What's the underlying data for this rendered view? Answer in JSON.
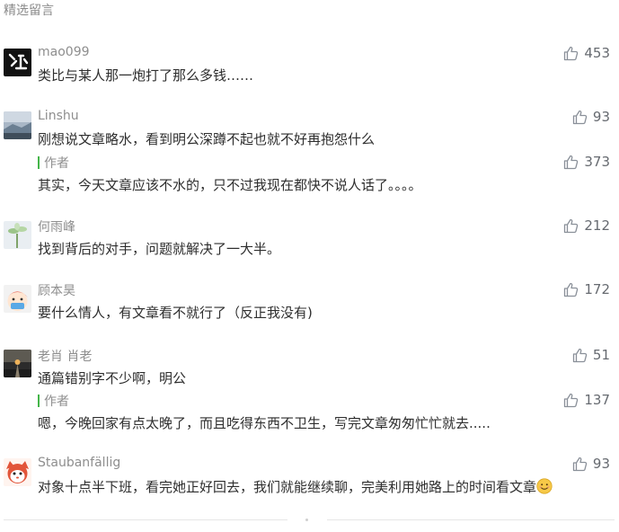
{
  "header": {
    "title": "精选留言"
  },
  "comments": [
    {
      "name": "mao099",
      "text": "类比与某人那一炮打了那么多钱……",
      "likes": "453"
    },
    {
      "name": "Linshu",
      "text": "刚想说文章略水，看到明公深蹲不起也就不好再抱怨什么",
      "likes": "93",
      "reply": {
        "label": "作者",
        "text": "其实，今天文章应该不水的，只不过我现在都快不说人话了。。。。",
        "likes": "373"
      }
    },
    {
      "name": "何雨峰",
      "text": "找到背后的对手，问题就解决了一大半。",
      "likes": "212"
    },
    {
      "name": "顾本昊",
      "text": "要什么情人，有文章看不就行了（反正我没有)",
      "likes": "172"
    },
    {
      "name": "老肖 肖老",
      "text": "通篇错别字不少啊，明公",
      "likes": "51",
      "reply": {
        "label": "作者",
        "text": "嗯，今晚回家有点太晚了，而且吃得东西不卫生，写完文章匆匆忙忙就去.....",
        "likes": "137"
      }
    },
    {
      "name": "Staubanfällig",
      "text": "对象十点半下班，看完她正好回去，我们就能继续聊，完美利用她路上的时间看文章",
      "likes": "93"
    }
  ],
  "colors": {
    "author_bar": "#44b549",
    "like_icon": "#8a9099",
    "name": "#8e8e8e"
  },
  "icons": {
    "like": "thumbs-up-icon",
    "emoji": "smile-emoji-icon"
  }
}
